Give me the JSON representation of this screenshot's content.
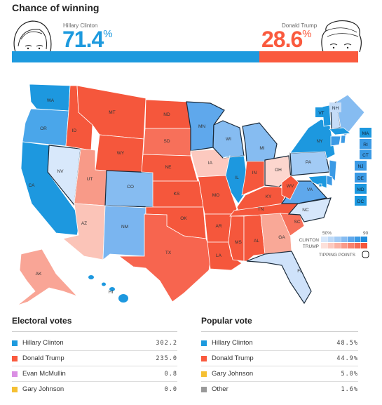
{
  "title": "Chance of winning",
  "colors": {
    "clinton": "#1d9ade",
    "trump": "#fa5a3e",
    "mcmullin": "#da8fe3",
    "johnson": "#f5c033",
    "other": "#999999"
  },
  "clinton": {
    "name": "Hillary Clinton",
    "pct": "71.4",
    "pct_sign": "%",
    "chance": 71.4
  },
  "trump": {
    "name": "Donald Trump",
    "pct": "28.6",
    "pct_sign": "%",
    "chance": 28.6
  },
  "legend": {
    "low": "50%",
    "high": "90",
    "clinton": "CLINTON",
    "trump": "TRUMP",
    "tipping": "TIPPING POINTS",
    "clinton_scale": [
      "#d6e7fb",
      "#bcd9f8",
      "#a2cbf5",
      "#86bcf1",
      "#5fa8ec",
      "#3b9ae5",
      "#1d8ddd"
    ],
    "trump_scale": [
      "#fde0da",
      "#fcc9bf",
      "#fbb2a4",
      "#f99a89",
      "#f8826e",
      "#f66b54",
      "#f5573c"
    ]
  },
  "states": [
    {
      "id": "WA",
      "color": "#1d98df"
    },
    {
      "id": "OR",
      "color": "#4aa6ea"
    },
    {
      "id": "CA",
      "color": "#1d98df"
    },
    {
      "id": "NV",
      "color": "#d8e8fb"
    },
    {
      "id": "ID",
      "color": "#f5573c"
    },
    {
      "id": "MT",
      "color": "#f5573c"
    },
    {
      "id": "WY",
      "color": "#f5573c"
    },
    {
      "id": "UT",
      "color": "#f89a88"
    },
    {
      "id": "AZ",
      "color": "#fbc4b8"
    },
    {
      "id": "CO",
      "color": "#86bcf1"
    },
    {
      "id": "NM",
      "color": "#7ab5f0"
    },
    {
      "id": "ND",
      "color": "#f5573c"
    },
    {
      "id": "SD",
      "color": "#f7705a"
    },
    {
      "id": "NE",
      "color": "#f5573c"
    },
    {
      "id": "KS",
      "color": "#f5573c"
    },
    {
      "id": "OK",
      "color": "#f5573c"
    },
    {
      "id": "TX",
      "color": "#f7654f"
    },
    {
      "id": "MN",
      "color": "#5fa8ec"
    },
    {
      "id": "IA",
      "color": "#fcc9bf"
    },
    {
      "id": "MO",
      "color": "#f5573c"
    },
    {
      "id": "AR",
      "color": "#f5573c"
    },
    {
      "id": "LA",
      "color": "#f5573c"
    },
    {
      "id": "WI",
      "color": "#86bcf1"
    },
    {
      "id": "IL",
      "color": "#1d98df"
    },
    {
      "id": "MI",
      "color": "#86bcf1"
    },
    {
      "id": "IN",
      "color": "#f5573c"
    },
    {
      "id": "OH",
      "color": "#fcd6ce"
    },
    {
      "id": "KY",
      "color": "#f5573c"
    },
    {
      "id": "TN",
      "color": "#f5573c"
    },
    {
      "id": "MS",
      "color": "#f5573c"
    },
    {
      "id": "AL",
      "color": "#f5573c"
    },
    {
      "id": "GA",
      "color": "#f9a897"
    },
    {
      "id": "FL",
      "color": "#cfe2fa"
    },
    {
      "id": "SC",
      "color": "#f7705a"
    },
    {
      "id": "NC",
      "color": "#d6e7fb"
    },
    {
      "id": "VA",
      "color": "#5fa8ec"
    },
    {
      "id": "WV",
      "color": "#f5573c"
    },
    {
      "id": "PA",
      "color": "#a2cbf5"
    },
    {
      "id": "NY",
      "color": "#1d98df"
    },
    {
      "id": "VT",
      "color": "#1d98df"
    },
    {
      "id": "NH",
      "color": "#c5dcf7"
    },
    {
      "id": "ME",
      "color": "#86bcf1"
    },
    {
      "id": "MA",
      "color": "#1d98df"
    },
    {
      "id": "RI",
      "color": "#3b9ae5"
    },
    {
      "id": "CT",
      "color": "#3b9ae5"
    },
    {
      "id": "NJ",
      "color": "#3b9ae5"
    },
    {
      "id": "DE",
      "color": "#3b9ae5"
    },
    {
      "id": "MD",
      "color": "#1d98df"
    },
    {
      "id": "DC",
      "color": "#1d98df"
    },
    {
      "id": "AK",
      "color": "#f9a596"
    },
    {
      "id": "HI",
      "color": "#1d98df"
    }
  ],
  "electoral": {
    "title": "Electoral votes",
    "rows": [
      {
        "name": "Hillary Clinton",
        "value": "302.2",
        "color": "#1d9ade"
      },
      {
        "name": "Donald Trump",
        "value": "235.0",
        "color": "#fa5a3e"
      },
      {
        "name": "Evan McMullin",
        "value": "0.8",
        "color": "#da8fe3"
      },
      {
        "name": "Gary Johnson",
        "value": "0.0",
        "color": "#f5c033"
      }
    ]
  },
  "popular": {
    "title": "Popular vote",
    "rows": [
      {
        "name": "Hillary Clinton",
        "value": "48.5%",
        "color": "#1d9ade"
      },
      {
        "name": "Donald Trump",
        "value": "44.9%",
        "color": "#fa5a3e"
      },
      {
        "name": "Gary Johnson",
        "value": "5.0%",
        "color": "#f5c033"
      },
      {
        "name": "Other",
        "value": "1.6%",
        "color": "#999999"
      }
    ]
  }
}
